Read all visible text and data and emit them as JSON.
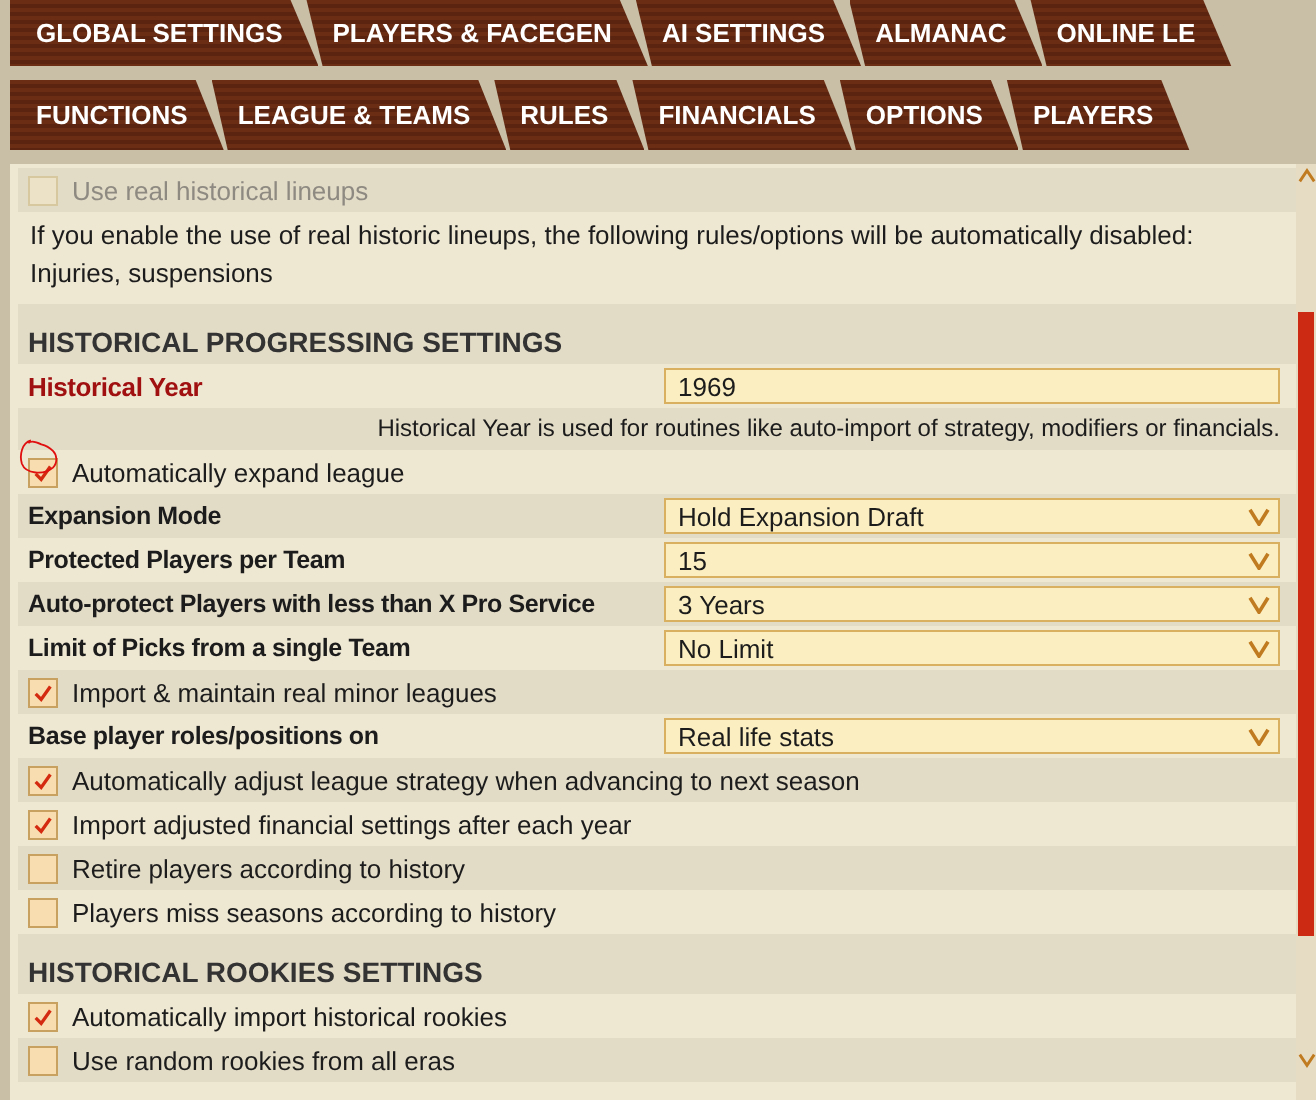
{
  "tab_rows": [
    [
      "GLOBAL SETTINGS",
      "PLAYERS & FACEGEN",
      "AI SETTINGS",
      "ALMANAC",
      "ONLINE LE"
    ],
    [
      "FUNCTIONS",
      "LEAGUE & TEAMS",
      "RULES",
      "FINANCIALS",
      "OPTIONS",
      "PLAYERS"
    ]
  ],
  "rows": [
    {
      "kind": "checkbox",
      "label": "Use real historical lineups",
      "checked": false,
      "disabled": true
    },
    {
      "kind": "note",
      "text": "If you enable the use of real historic lineups, the following rules/options will be automatically disabled: Injuries, suspensions"
    },
    {
      "kind": "heading",
      "text": "HISTORICAL PROGRESSING SETTINGS"
    },
    {
      "kind": "input",
      "label": "Historical Year",
      "value": "1969"
    },
    {
      "kind": "hint",
      "text": "Historical Year is used for routines like auto-import of strategy, modifiers or financials."
    },
    {
      "kind": "checkbox",
      "label": "Automatically expand league",
      "checked": true,
      "disabled": false,
      "circled": true
    },
    {
      "kind": "select",
      "label": "Expansion Mode",
      "value": "Hold Expansion Draft"
    },
    {
      "kind": "select",
      "label": "Protected Players per Team",
      "value": "15"
    },
    {
      "kind": "select",
      "label": "Auto-protect Players with less than X Pro Service",
      "value": "3 Years"
    },
    {
      "kind": "select",
      "label": "Limit of Picks from a single Team",
      "value": "No Limit"
    },
    {
      "kind": "checkbox",
      "label": "Import & maintain real minor leagues",
      "checked": true,
      "disabled": false
    },
    {
      "kind": "select",
      "label": "Base player roles/positions on",
      "value": "Real life stats"
    },
    {
      "kind": "checkbox",
      "label": "Automatically adjust league strategy when advancing to next season",
      "checked": true,
      "disabled": false
    },
    {
      "kind": "checkbox",
      "label": "Import adjusted financial settings after each year",
      "checked": true,
      "disabled": false
    },
    {
      "kind": "checkbox",
      "label": "Retire players according to history",
      "checked": false,
      "disabled": false
    },
    {
      "kind": "checkbox",
      "label": "Players miss seasons according to history",
      "checked": false,
      "disabled": false
    },
    {
      "kind": "heading",
      "text": "HISTORICAL ROOKIES SETTINGS"
    },
    {
      "kind": "checkbox",
      "label": "Automatically import historical rookies",
      "checked": true,
      "disabled": false
    },
    {
      "kind": "checkbox",
      "label": "Use random rookies from all eras",
      "checked": false,
      "disabled": false
    }
  ]
}
